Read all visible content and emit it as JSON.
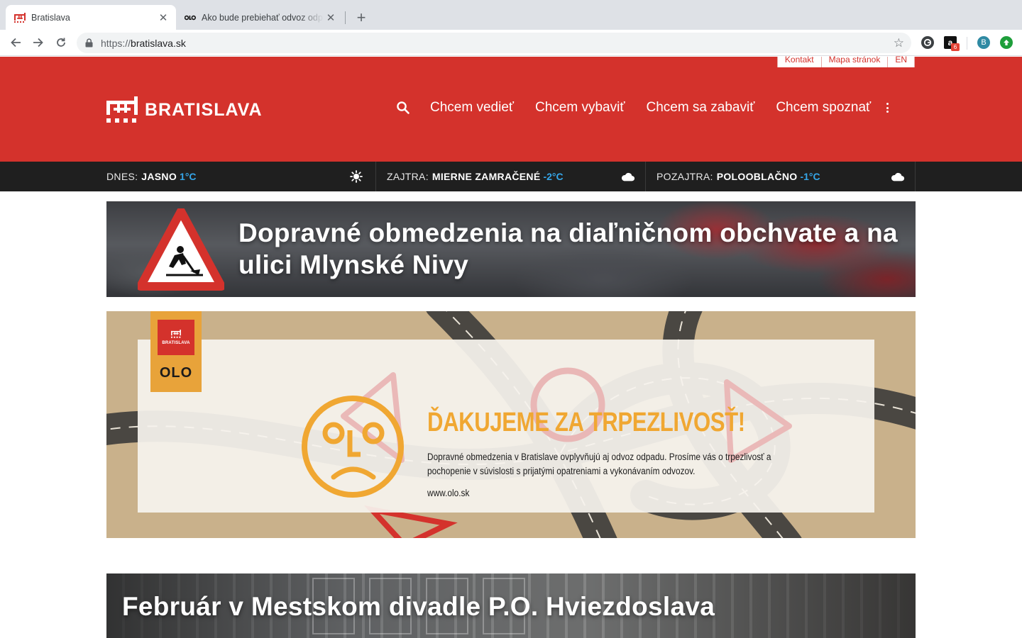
{
  "browser": {
    "tabs": [
      {
        "title": "Bratislava",
        "active": true
      },
      {
        "title": "Ako bude prebiehať odvoz odpadu",
        "active": false
      }
    ],
    "url_scheme": "https://",
    "url_host": "bratislava.sk",
    "extension_badge": "6",
    "profile_initial": "B"
  },
  "header": {
    "util_links": [
      "Kontakt",
      "Mapa stránok",
      "EN"
    ],
    "logo_text": "BRATISLAVA",
    "nav": [
      "Chcem vedieť",
      "Chcem vybaviť",
      "Chcem sa zabaviť",
      "Chcem spoznať"
    ]
  },
  "weather": [
    {
      "label": "DNES:",
      "condition": "JASNO",
      "temp": "1°C",
      "icon": "sun-icon"
    },
    {
      "label": "ZAJTRA:",
      "condition": "MIERNE ZAMRAČENÉ",
      "temp": "-2°C",
      "icon": "cloud-icon"
    },
    {
      "label": "POZAJTRA:",
      "condition": "POLOOBLAČNO",
      "temp": "-1°C",
      "icon": "cloud-icon"
    }
  ],
  "banners": {
    "traffic": {
      "headline": "Dopravné obmedzenia na diaľničnom obchvate a na ulici Mlynské Nivy"
    },
    "olo": {
      "badge_city": "BRATISLAVA",
      "badge_brand": "OLO",
      "title": "ĎAKUJEME ZA TRPEZLIVOSŤ!",
      "text": "Dopravné obmedzenia v Bratislave ovplyvňujú aj odvoz odpadu. Prosíme vás o trpezlivosť a pochopenie v súvislosti s prijatými opatreniami a vykonávaním odvozov.",
      "url": "www.olo.sk"
    },
    "theatre": {
      "headline": "Február v Mestskom divadle P.O. Hviezdoslava"
    }
  },
  "colors": {
    "brand_red": "#d4322c",
    "weather_bg": "#1f1f1f",
    "temp_blue": "#35a6e8",
    "olo_orange": "#f0a732"
  }
}
